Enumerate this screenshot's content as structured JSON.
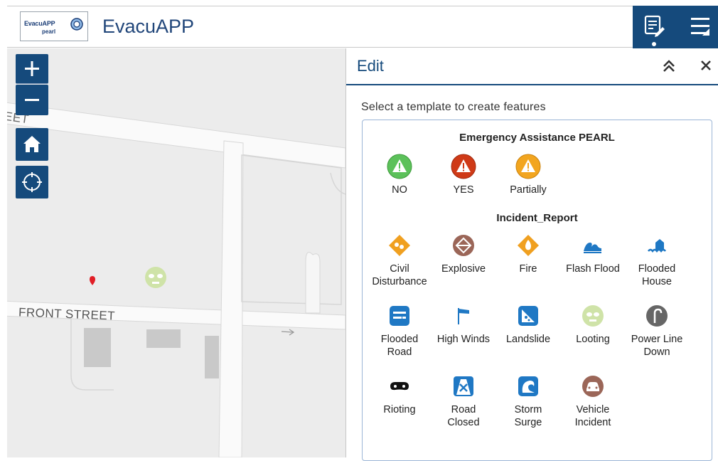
{
  "header": {
    "logo_line1": "EvacuAPP",
    "logo_line2": "pearl",
    "title": "EvacuAPP",
    "edit_icon": "edit-list-icon",
    "menu_icon": "menu-icon"
  },
  "map": {
    "zoom_in_label": "+",
    "zoom_out_label": "−",
    "street_front": "FRONT STREET",
    "street_top": "EET"
  },
  "panel": {
    "title": "Edit",
    "instruction": "Select a template to create features",
    "groups": [
      {
        "title": "Emergency Assistance PEARL",
        "items": [
          {
            "label": "NO",
            "icon": "warning-green-icon",
            "color": "#5cc15a"
          },
          {
            "label": "YES",
            "icon": "warning-red-icon",
            "color": "#cf3a17"
          },
          {
            "label": "Partially",
            "icon": "warning-orange-icon",
            "color": "#f2a51f"
          }
        ]
      },
      {
        "title": "Incident_Report",
        "items": [
          {
            "label_line1": "Civil",
            "label_line2": "Disturbance",
            "icon": "civil-disturbance-icon"
          },
          {
            "label_line1": "Explosive",
            "label_line2": "",
            "icon": "explosive-icon"
          },
          {
            "label_line1": "Fire",
            "label_line2": "",
            "icon": "fire-icon"
          },
          {
            "label_line1": "Flash Flood",
            "label_line2": "",
            "icon": "flash-flood-icon"
          },
          {
            "label_line1": "Flooded",
            "label_line2": "House",
            "icon": "flooded-house-icon"
          },
          {
            "label_line1": "Flooded",
            "label_line2": "Road",
            "icon": "flooded-road-icon"
          },
          {
            "label_line1": "High Winds",
            "label_line2": "",
            "icon": "high-winds-icon"
          },
          {
            "label_line1": "Landslide",
            "label_line2": "",
            "icon": "landslide-icon"
          },
          {
            "label_line1": "Looting",
            "label_line2": "",
            "icon": "looting-icon"
          },
          {
            "label_line1": "Power Line",
            "label_line2": "Down",
            "icon": "power-line-down-icon"
          },
          {
            "label_line1": "Rioting",
            "label_line2": "",
            "icon": "rioting-icon"
          },
          {
            "label_line1": "Road",
            "label_line2": "Closed",
            "icon": "road-closed-icon"
          },
          {
            "label_line1": "Storm",
            "label_line2": "Surge",
            "icon": "storm-surge-icon"
          },
          {
            "label_line1": "Vehicle",
            "label_line2": "Incident",
            "icon": "vehicle-incident-icon"
          }
        ]
      }
    ]
  },
  "colors": {
    "primary": "#154a7c",
    "map_background": "#ececec",
    "incident_orange": "#f0a020",
    "incident_blue": "#1f78c4"
  }
}
